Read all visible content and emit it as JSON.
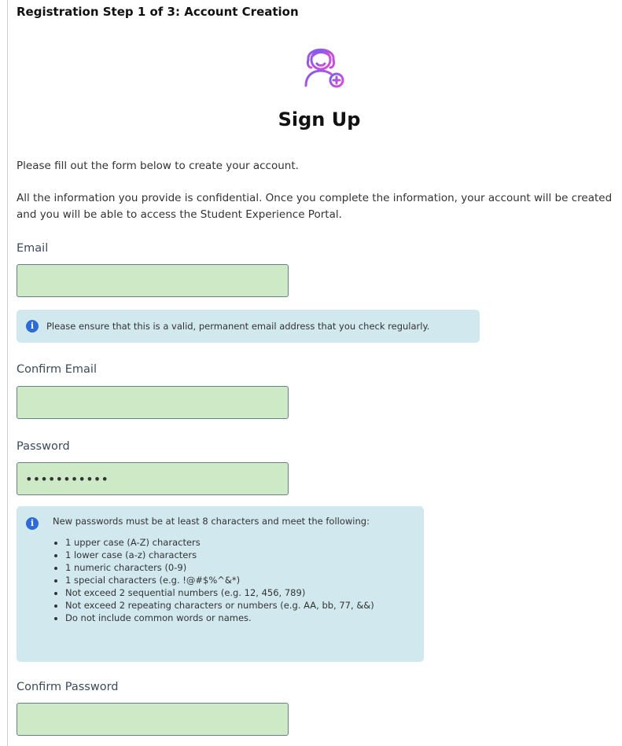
{
  "step_title": "Registration Step 1 of 3: Account Creation",
  "avatar_icon": "user-add-icon",
  "heading": "Sign Up",
  "intro": "Please fill out the form below to create your account.",
  "confidential_text": "All the information you provide is confidential. Once you complete the information, your account will be created and you will be able to access the Student Experience Portal.",
  "email": {
    "label": "Email",
    "value": ""
  },
  "email_info": "Please ensure that this is a valid, permanent email address that you check regularly.",
  "confirm_email": {
    "label": "Confirm Email",
    "value": ""
  },
  "password": {
    "label": "Password",
    "value": "•••••••••••"
  },
  "password_rules": {
    "lead": "New passwords must be at least 8 characters and meet the following:",
    "items": [
      "1 upper case (A-Z) characters",
      "1 lower case (a-z) characters",
      "1 numeric characters (0-9)",
      "1 special characters (e.g. !@#$%^&*)",
      "Not exceed 2 sequential numbers (e.g. 12, 456, 789)",
      "Not exceed 2 repeating characters or numbers (e.g. AA, bb, 77, &&)",
      "Do not include common words or names."
    ]
  },
  "confirm_password": {
    "label": "Confirm Password",
    "value": ""
  },
  "colors": {
    "input_bg": "#cde9c6",
    "info_bg": "#d1e9ee",
    "info_icon": "#2e6bd6",
    "avatar_gradient": [
      "#7b5cf0",
      "#e24bd3"
    ]
  }
}
